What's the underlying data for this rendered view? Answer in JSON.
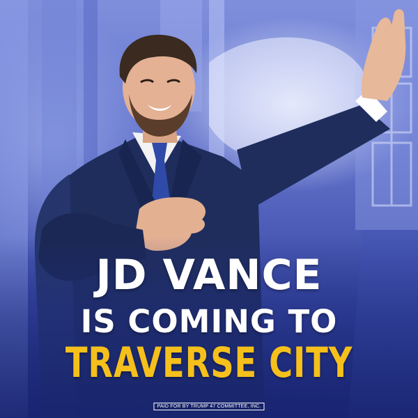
{
  "headline": {
    "line1": "JD VANCE",
    "line2": "IS COMING TO",
    "line3": "TRAVERSE CITY"
  },
  "disclaimer": "PAID FOR BY TRUMP 47 COMMITTEE, INC.",
  "colors": {
    "headline_white": "#ffffff",
    "headline_gold": "#f5c01c",
    "background_blue": "#3b4aa6",
    "suit_navy": "#1f2d5c"
  }
}
